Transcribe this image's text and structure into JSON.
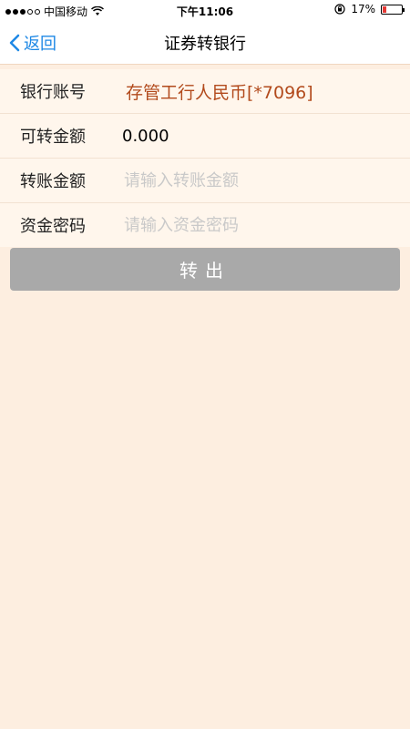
{
  "status_bar": {
    "carrier": "中国移动",
    "time": "下午11:06",
    "battery": "17%",
    "battery_level_percent": 17,
    "signal_dots_filled": 3,
    "signal_dots_total": 5,
    "icons": [
      "wifi-icon",
      "rotation-lock-icon",
      "battery-icon"
    ]
  },
  "navbar": {
    "back_label": "返回",
    "title": "证券转银行"
  },
  "form": {
    "bank_account": {
      "label": "银行账号",
      "value": "存管工行人民币[*7096]"
    },
    "available_amount": {
      "label": "可转金额",
      "value": "0.000"
    },
    "transfer_amount": {
      "label": "转账金额",
      "placeholder": "请输入转账金额"
    },
    "fund_password": {
      "label": "资金密码",
      "placeholder": "请输入资金密码"
    }
  },
  "submit_button": {
    "label": "转出"
  },
  "colors": {
    "background": "#fdeee0",
    "form_background": "#fff6ec",
    "accent_blue": "#1e88e5",
    "account_text": "#b24a1c",
    "button_disabled": "#a9a9a9",
    "battery_low": "#e53935"
  }
}
